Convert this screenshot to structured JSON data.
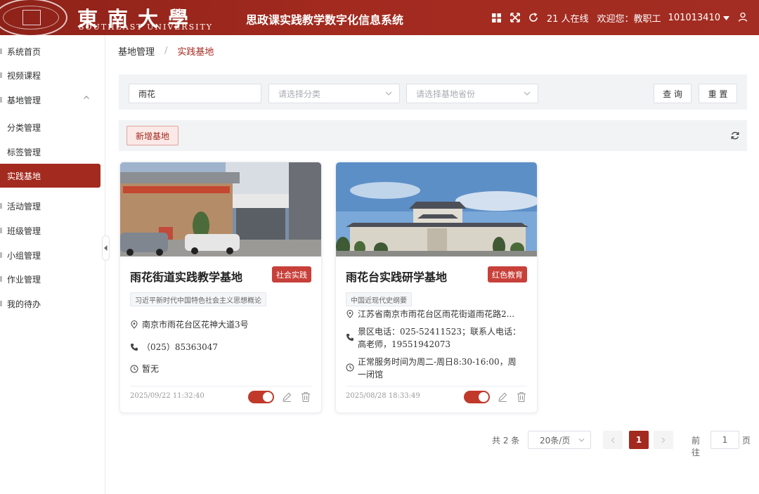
{
  "header": {
    "university_cn": "東南大學",
    "university_en": "SOUTHEAST UNIVERSITY",
    "system_title": "思政课实践教学数字化信息系统",
    "online_text": "21 人在线",
    "welcome_text": "欢迎您：教职工",
    "user_id": "101013410",
    "icons": [
      "grid-icon",
      "fullscreen-icon",
      "refresh-icon",
      "caret-down-icon",
      "user-icon"
    ]
  },
  "sidebar": {
    "items": [
      {
        "label": "系统首页"
      },
      {
        "label": "视频课程"
      },
      {
        "label": "基地管理"
      },
      {
        "label": "分类管理"
      },
      {
        "label": "标签管理"
      },
      {
        "label": "实践基地"
      },
      {
        "label": "活动管理"
      },
      {
        "label": "班级管理"
      },
      {
        "label": "小组管理"
      },
      {
        "label": "作业管理"
      },
      {
        "label": "我的待办"
      }
    ],
    "active_index": 5
  },
  "breadcrumb": {
    "parent": "基地管理",
    "separator": "/",
    "current": "实践基地"
  },
  "search": {
    "keyword_value": "雨花",
    "category_placeholder": "请选择分类",
    "province_placeholder": "请选择基地省份",
    "query_label": "查 询",
    "reset_label": "重 置"
  },
  "toolbar": {
    "add_label": "新增基地"
  },
  "cards": [
    {
      "title": "雨花街道实践教学基地",
      "tag": "社会实践",
      "chip": "习近平新时代中国特色社会主义思想概论",
      "address": "南京市雨花台区花神大道3号",
      "phone": "（025）85363047",
      "hours": "暂无",
      "date": "2025/09/22 11:32:40",
      "enabled": true
    },
    {
      "title": "雨花台实践研学基地",
      "tag": "红色教育",
      "chip": "中国近现代史纲要",
      "address": "江苏省南京市雨花台区雨花街道雨花路2...",
      "phone_line1": "景区电话：025-52411523；联系人电话：",
      "phone_line2": "高老师，19551942073",
      "hours_line1": "正常服务时间为周二-周日8:30-16:00，周",
      "hours_line2": "一闭馆",
      "date": "2025/08/28 18:33:49",
      "enabled": true
    }
  ],
  "pagination": {
    "total": "共 2 条",
    "page_size": "20条/页",
    "current_page": "1",
    "goto_label": "前往",
    "goto_value": "1",
    "page_unit": "页"
  },
  "colors": {
    "brand": "#a32a1f",
    "tag_red": "#c8403a",
    "panel_bg": "#f2f3f5"
  }
}
